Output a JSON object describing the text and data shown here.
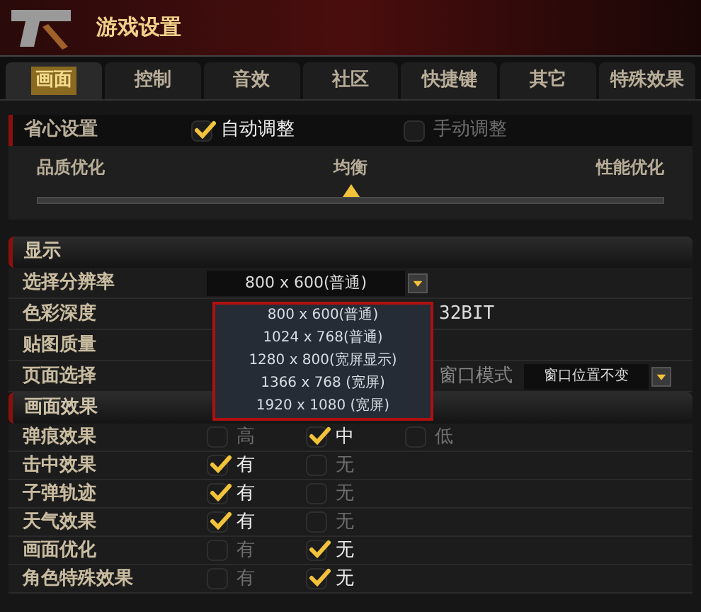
{
  "window": {
    "title": "游戏设置"
  },
  "tabs": [
    {
      "label": "画面",
      "selected": true
    },
    {
      "label": "控制",
      "selected": false
    },
    {
      "label": "音效",
      "selected": false
    },
    {
      "label": "社区",
      "selected": false
    },
    {
      "label": "快捷键",
      "selected": false
    },
    {
      "label": "其它",
      "selected": false
    },
    {
      "label": "特殊效果",
      "selected": false
    }
  ],
  "preset": {
    "label": "省心设置",
    "options": [
      {
        "label": "自动调整",
        "checked": true
      },
      {
        "label": "手动调整",
        "checked": false
      }
    ]
  },
  "slider": {
    "labels": [
      "品质优化",
      "均衡",
      "性能优化"
    ],
    "level": 0.5
  },
  "display": {
    "title": "显示",
    "rows": [
      {
        "kind": "select",
        "label": "选择分辨率",
        "value": "800 x 600(普通)"
      },
      {
        "kind": "text",
        "label": "色彩深度",
        "value": "32BIT"
      },
      {
        "kind": "empty",
        "label": "贴图质量"
      },
      {
        "kind": "window",
        "label": "页面选择",
        "option": "窗口模式",
        "value": "窗口位置不变"
      }
    ]
  },
  "resolution_menu": {
    "items": [
      "800 x 600(普通)",
      "1024 x 768(普通)",
      "1280 x 800(宽屏显示)",
      "1366 x 768 (宽屏)",
      "1920 x 1080 (宽屏)"
    ]
  },
  "effects": {
    "title": "画面效果",
    "rows": [
      {
        "label": "弹痕效果",
        "options": [
          {
            "label": "高",
            "checked": false
          },
          {
            "label": "中",
            "checked": true
          },
          {
            "label": "低",
            "checked": false
          }
        ]
      },
      {
        "label": "击中效果",
        "options": [
          {
            "label": "有",
            "checked": true
          },
          {
            "label": "无",
            "checked": false
          }
        ]
      },
      {
        "label": "子弹轨迹",
        "options": [
          {
            "label": "有",
            "checked": true
          },
          {
            "label": "无",
            "checked": false
          }
        ]
      },
      {
        "label": "天气效果",
        "options": [
          {
            "label": "有",
            "checked": true
          },
          {
            "label": "无",
            "checked": false
          }
        ]
      },
      {
        "label": "画面优化",
        "options": [
          {
            "label": "有",
            "checked": false
          },
          {
            "label": "无",
            "checked": true
          }
        ]
      },
      {
        "label": "角色特殊效果",
        "options": [
          {
            "label": "有",
            "checked": false
          },
          {
            "label": "无",
            "checked": true
          }
        ]
      }
    ]
  }
}
